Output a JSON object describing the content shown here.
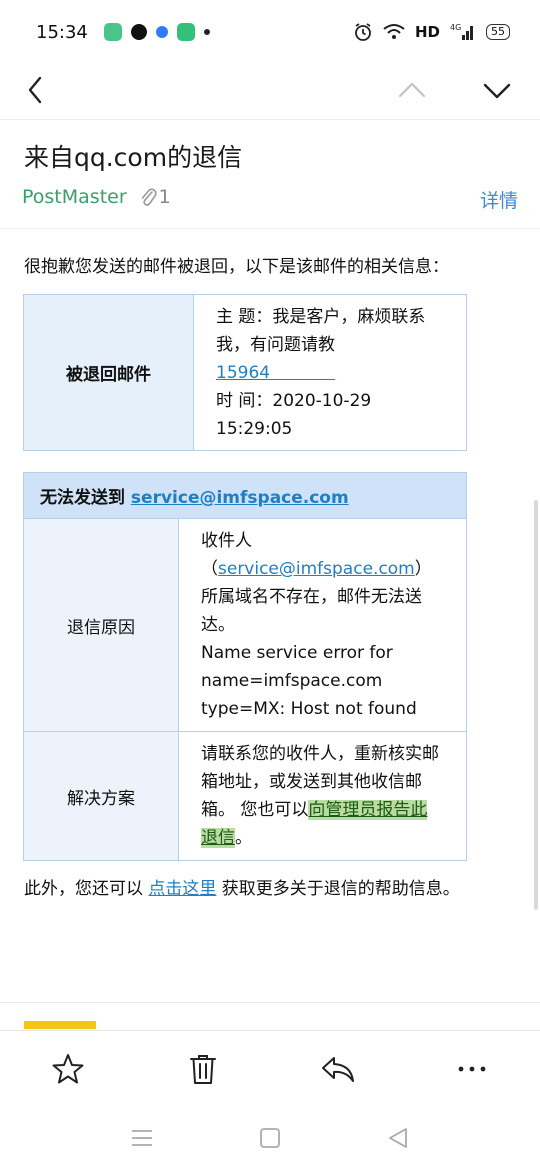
{
  "status_bar": {
    "time": "15:34",
    "network": "HD",
    "signal_label": "4G",
    "battery": "55"
  },
  "mail": {
    "subject": "来自qq.com的退信",
    "sender": "PostMaster",
    "attachment_count": "1",
    "details_label": "详情"
  },
  "body": {
    "intro": "很抱歉您发送的邮件被退回，以下是该邮件的相关信息：",
    "returned_mail": {
      "label": "被退回邮件",
      "subject_line": "主 题：我是客户，麻烦联系我，有问题请教",
      "subject_link": "15964",
      "time_line": "时 间：2020-10-29 15:29:05"
    },
    "failure": {
      "header_prefix": "无法发送到 ",
      "header_email": "service@imfspace.com",
      "reason_label": "退信原因",
      "reason_prefix": "收件人（",
      "reason_email": "service@imfspace.com",
      "reason_suffix": "）所属域名不存在，邮件无法送达。",
      "reason_english": "Name service error for name=imfspace.com type=MX: Host not found",
      "solution_label": "解决方案",
      "solution_text": "请联系您的收件人，重新核实邮箱地址，或发送到其他收信邮箱。 您也可以",
      "solution_link": "向管理员报告此退信",
      "solution_end": "。"
    },
    "outro_prefix": "此外，您还可以 ",
    "outro_link": "点击这里",
    "outro_suffix": " 获取更多关于退信的帮助信息。"
  },
  "toolbar": {
    "star_icon": "star-icon",
    "delete_icon": "trash-icon",
    "reply_icon": "reply-icon",
    "more_icon": "more-icon"
  },
  "colors": {
    "sender": "#3aa06a",
    "link": "#1e7fc6",
    "table_border": "#b7d0ea",
    "table_header": "#cfe2f7",
    "highlight": "#b8dca1"
  }
}
